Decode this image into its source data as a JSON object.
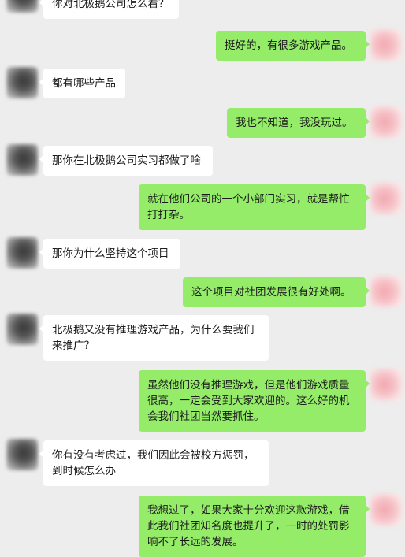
{
  "colors": {
    "background": "#ededed",
    "incoming_bubble": "#ffffff",
    "outgoing_bubble": "#95ec69",
    "text": "#1b1b1b"
  },
  "messages": [
    {
      "from": "them",
      "text": "你对北极鹅公司怎么看？"
    },
    {
      "from": "me",
      "text": "挺好的，有很多游戏产品。"
    },
    {
      "from": "them",
      "text": "都有哪些产品"
    },
    {
      "from": "me",
      "text": "我也不知道，我没玩过。"
    },
    {
      "from": "them",
      "text": "那你在北极鹅公司实习都做了啥"
    },
    {
      "from": "me",
      "text": "就在他们公司的一个小部门实习，就是帮忙打打杂。"
    },
    {
      "from": "them",
      "text": "那你为什么坚持这个项目"
    },
    {
      "from": "me",
      "text": "这个项目对社团发展很有好处啊。"
    },
    {
      "from": "them",
      "text": "北极鹅又没有推理游戏产品，为什么要我们来推广？"
    },
    {
      "from": "me",
      "text": "虽然他们没有推理游戏，但是他们游戏质量很高，一定会受到大家欢迎的。这么好的机会我们社团当然要抓住。"
    },
    {
      "from": "them",
      "text": "你有没有考虑过，我们因此会被校方惩罚，到时候怎么办"
    },
    {
      "from": "me",
      "text": "我想过了，如果大家十分欢迎这款游戏，借此我们社团知名度也提升了，一时的处罚影响不了长远的发展。"
    }
  ]
}
